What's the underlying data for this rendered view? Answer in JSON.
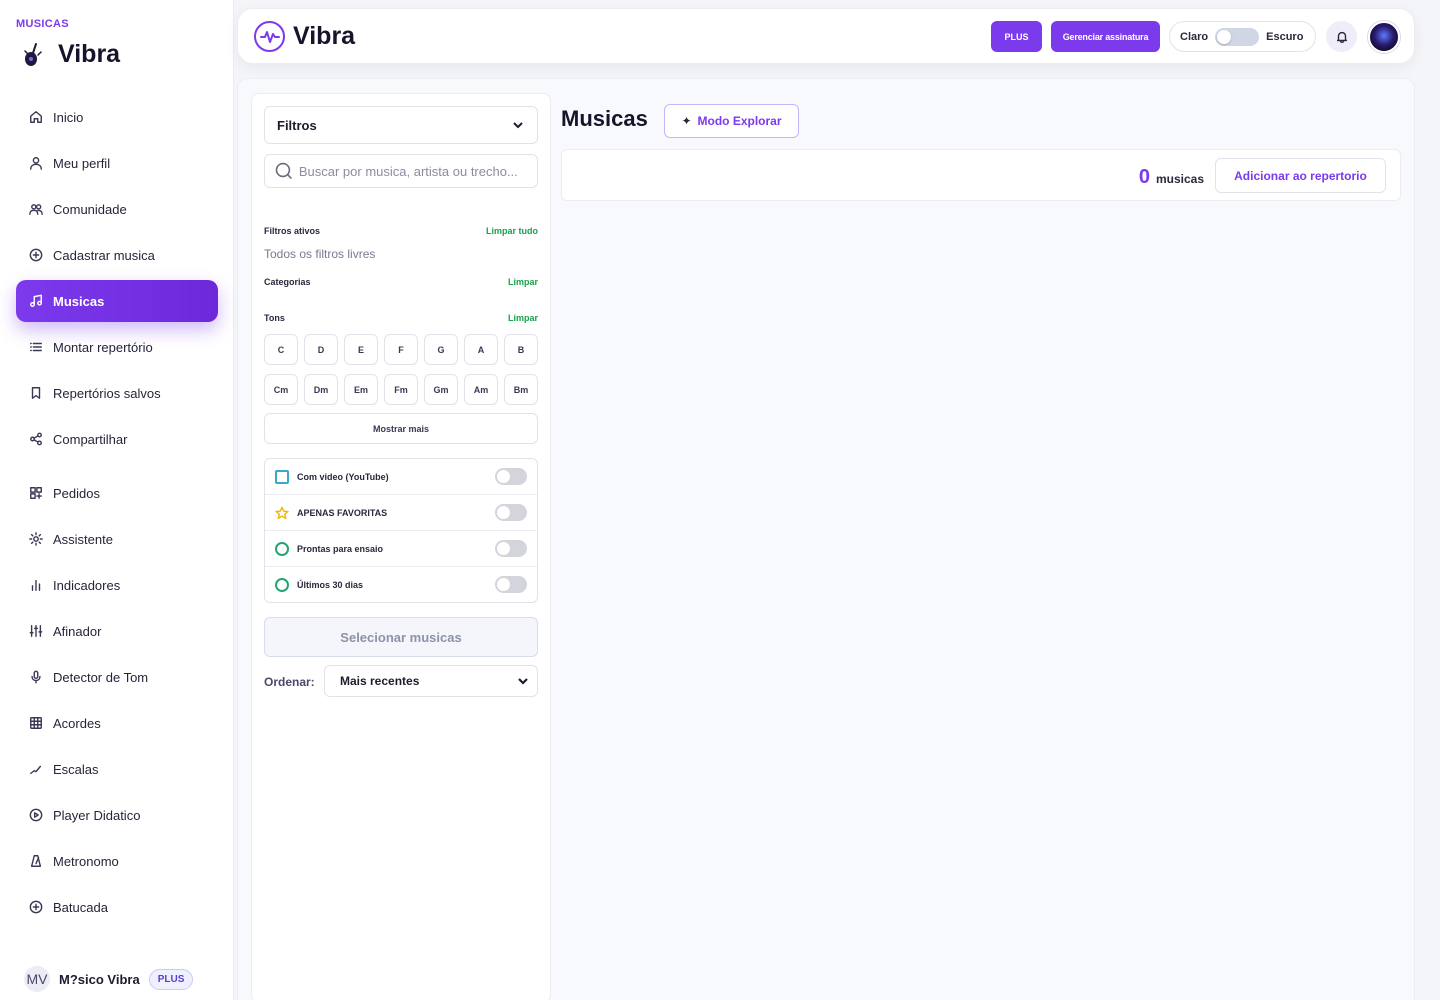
{
  "sidebar": {
    "eyebrow": "MUSICAS",
    "brand": "Vibra",
    "items": [
      {
        "label": "Inicio",
        "icon": "home-icon"
      },
      {
        "label": "Meu perfil",
        "icon": "user-icon"
      },
      {
        "label": "Comunidade",
        "icon": "users-icon"
      },
      {
        "label": "Cadastrar musica",
        "icon": "plus-circle-icon"
      },
      {
        "label": "Musicas",
        "icon": "music-note-icon",
        "active": true
      },
      {
        "label": "Montar repertório",
        "icon": "list-icon"
      },
      {
        "label": "Repertórios salvos",
        "icon": "bookmark-icon"
      },
      {
        "label": "Compartilhar",
        "icon": "share-icon"
      },
      {
        "label": "Pedidos",
        "icon": "grid-icon"
      },
      {
        "label": "Assistente",
        "icon": "sun-icon"
      },
      {
        "label": "Indicadores",
        "icon": "bar-chart-icon"
      },
      {
        "label": "Afinador",
        "icon": "sliders-icon"
      },
      {
        "label": "Detector de Tom",
        "icon": "microphone-icon"
      },
      {
        "label": "Acordes",
        "icon": "table-icon"
      },
      {
        "label": "Escalas",
        "icon": "trend-icon"
      },
      {
        "label": "Player Didatico",
        "icon": "play-circle-icon"
      },
      {
        "label": "Metronomo",
        "icon": "metronome-icon"
      },
      {
        "label": "Batucada",
        "icon": "plus-circle-icon"
      }
    ],
    "user": {
      "initials": "MV",
      "name": "M?sico Vibra",
      "badge": "PLUS"
    }
  },
  "topbar": {
    "brand": "Vibra",
    "plus_label": "PLUS",
    "manage_label": "Gerenciar assinatura",
    "theme_light": "Claro",
    "theme_dark": "Escuro",
    "theme_dark_enabled": false
  },
  "filters": {
    "dropdown_label": "Filtros",
    "search_placeholder": "Buscar por musica, artista ou trecho...",
    "search_value": "",
    "active_title": "Filtros ativos",
    "clear_all": "Limpar tudo",
    "active_hint": "Todos os filtros livres",
    "categories_title": "Categorias",
    "categories_clear": "Limpar",
    "keys_title": "Tons",
    "keys_clear": "Limpar",
    "keys_major": [
      "C",
      "D",
      "E",
      "F",
      "G",
      "A",
      "B"
    ],
    "keys_minor": [
      "Cm",
      "Dm",
      "Em",
      "Fm",
      "Gm",
      "Am",
      "Bm"
    ],
    "show_more": "Mostrar mais",
    "toggles": [
      {
        "label": "Com video (YouTube)",
        "icon": "checkbox-icon",
        "on": false
      },
      {
        "label": "APENAS FAVORITAS",
        "icon": "star-icon",
        "on": false
      },
      {
        "label": "Prontas para ensaio",
        "icon": "circle-icon",
        "on": false
      },
      {
        "label": "Últimos 30 dias",
        "icon": "circle-icon",
        "on": false
      }
    ],
    "select_button": "Selecionar musicas",
    "order_label": "Ordenar:",
    "order_value": "Mais recentes"
  },
  "content": {
    "title": "Musicas",
    "explore_label": "Modo Explorar",
    "count": "0",
    "count_label": "musicas",
    "add_label": "Adicionar ao repertorio"
  },
  "colors": {
    "accent": "#7c3aed",
    "success": "#16a34a",
    "star": "#f5b400"
  }
}
